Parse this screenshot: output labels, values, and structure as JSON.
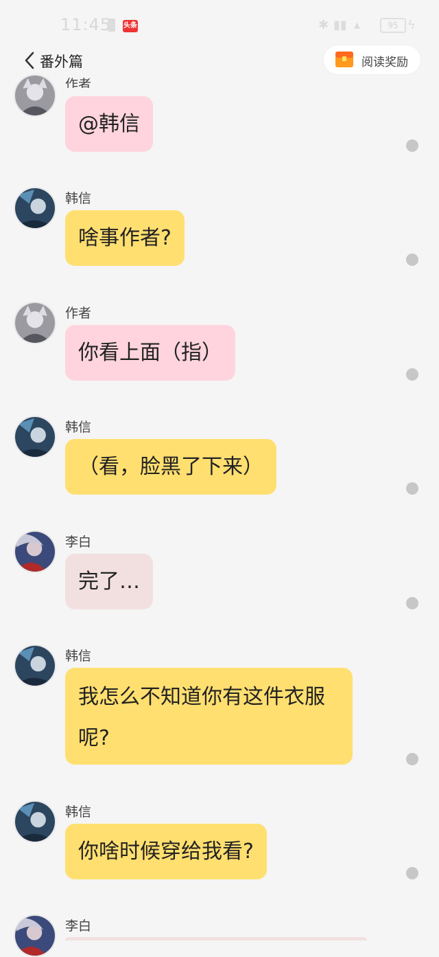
{
  "status_bar": {
    "time": "11:45",
    "news_app_label": "头条",
    "battery": "95"
  },
  "header": {
    "title": "番外篇",
    "reward_label": "阅读奖励"
  },
  "messages": [
    {
      "name": "作者",
      "text": "@韩信"
    },
    {
      "name": "韩信",
      "text": "啥事作者?"
    },
    {
      "name": "作者",
      "text": "你看上面（指）"
    },
    {
      "name": "韩信",
      "text": "（看，脸黑了下来）"
    },
    {
      "name": "李白",
      "text": "完了…"
    },
    {
      "name": "韩信",
      "text": "我怎么不知道你有这件衣服呢?"
    },
    {
      "name": "韩信",
      "text": "你啥时候穿给我看?"
    },
    {
      "name": "李白",
      "text": ""
    }
  ],
  "colors": {
    "author_bubble": "#ffd4de",
    "hanxin_bubble": "#ffdf70",
    "libai_bubble": "#f2e0e0",
    "background": "#f5f5f5"
  }
}
